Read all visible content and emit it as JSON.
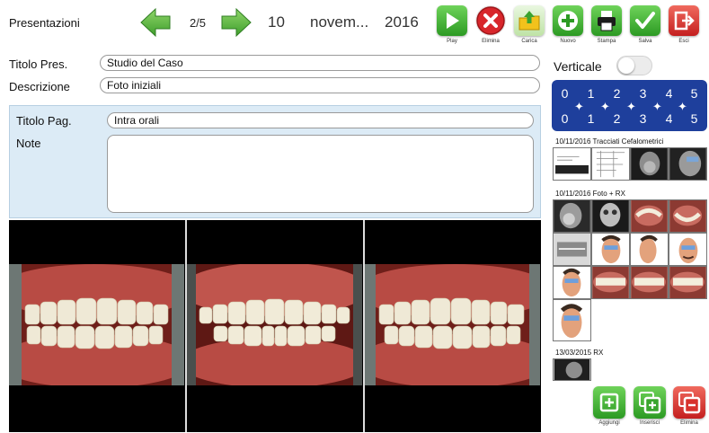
{
  "header": {
    "title": "Presentazioni",
    "page_indicator": "2/5",
    "date": {
      "day": "10",
      "month": "novem...",
      "year": "2016"
    }
  },
  "toolbar": {
    "play": "Play",
    "delete": "Elimina",
    "load": "Carica",
    "new": "Nuovo",
    "print": "Stampa",
    "save": "Salva",
    "exit": "Esci"
  },
  "form": {
    "title_label": "Titolo Pres.",
    "title_value": "Studio del Caso",
    "description_label": "Descrizione",
    "description_value": "Foto iniziali"
  },
  "page": {
    "title_label": "Titolo Pag.",
    "title_value": "Intra orali",
    "notes_label": "Note",
    "notes_value": ""
  },
  "sidebar": {
    "vertical_label": "Verticale",
    "vertical_on": false,
    "number_rows": [
      [
        "0",
        "1",
        "2",
        "3",
        "4",
        "5"
      ],
      [
        "0",
        "1",
        "2",
        "3",
        "4",
        "5"
      ]
    ],
    "sections": [
      {
        "label": "10/11/2016 Tracciati Cefalometrici"
      },
      {
        "label": "10/11/2016 Foto + RX"
      },
      {
        "label": "13/03/2015 RX"
      }
    ]
  },
  "bottom_actions": {
    "add": "Aggiungi",
    "insert": "Inserisci",
    "delete": "Elimina"
  },
  "colors": {
    "accent_green": "#3cae3a",
    "accent_red": "#d8262b",
    "grid_blue": "#1e3f9c",
    "panel_blue": "#dcebf6"
  }
}
